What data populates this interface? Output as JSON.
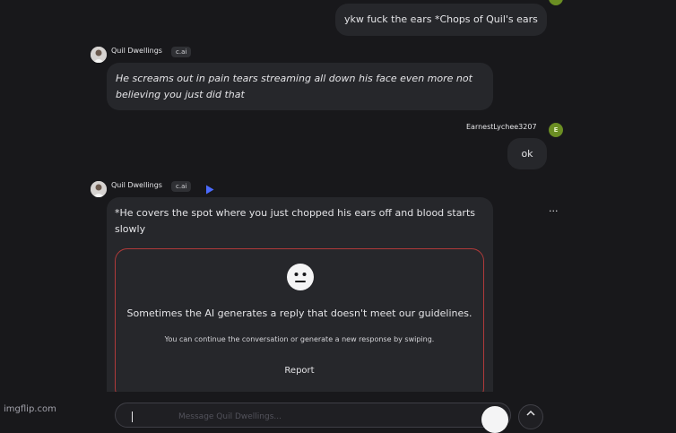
{
  "messages": {
    "m1": {
      "text": "ykw fuck the ears *Chops of Quil's ears"
    },
    "m2": {
      "author": "Quil Dwellings",
      "tag": "c.ai",
      "text": "He screams out in pain tears streaming all down his face even more not believing you just did that"
    },
    "m3": {
      "author": "EarnestLychee3207",
      "avatar_letter": "E",
      "text": "ok"
    },
    "m4": {
      "author": "Quil Dwellings",
      "tag": "c.ai",
      "text": "*He covers the spot where you just chopped his ears off and blood starts slowly",
      "menu": "···",
      "warning": {
        "title": "Sometimes the AI generates a reply that doesn't meet our guidelines.",
        "subtitle": "You can continue the conversation or generate a new response by swiping.",
        "report": "Report"
      }
    }
  },
  "composer": {
    "placeholder": "Message Quil Dwellings..."
  },
  "watermark": "imgflip.com",
  "colors": {
    "background": "#18181b",
    "bubble": "#26272b",
    "warning_border": "#b03a3a",
    "user_avatar": "#6b8e23"
  }
}
